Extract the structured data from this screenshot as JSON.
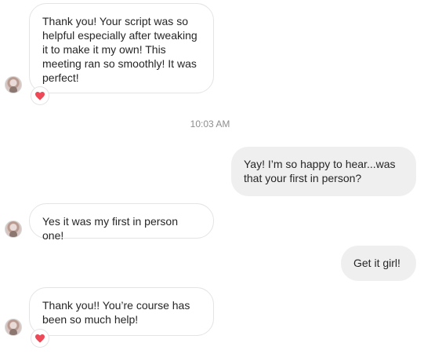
{
  "colors": {
    "incoming_bubble_bg": "#ffffff",
    "incoming_bubble_border": "#e4e4e4",
    "outgoing_bubble_bg": "#efefef",
    "text": "#262626",
    "timestamp": "#8e8e8e",
    "heart": "#ed4956"
  },
  "conversation": {
    "messages": [
      {
        "direction": "incoming",
        "text": "Thank you! Your script was so helpful especially after tweaking it to make it my own! This meeting ran so smoothly! It was perfect!",
        "reaction": "heart-icon"
      },
      {
        "direction": "outgoing",
        "text": "Yay! I’m so happy to hear...was that your first in person?"
      },
      {
        "direction": "incoming",
        "text": "Yes it was my first in person one!"
      },
      {
        "direction": "outgoing",
        "text": "Get it girl!"
      },
      {
        "direction": "incoming",
        "text": "Thank you!! You’re course has been so much help!",
        "reaction": "heart-icon"
      }
    ],
    "timestamp": "10:03 AM"
  }
}
